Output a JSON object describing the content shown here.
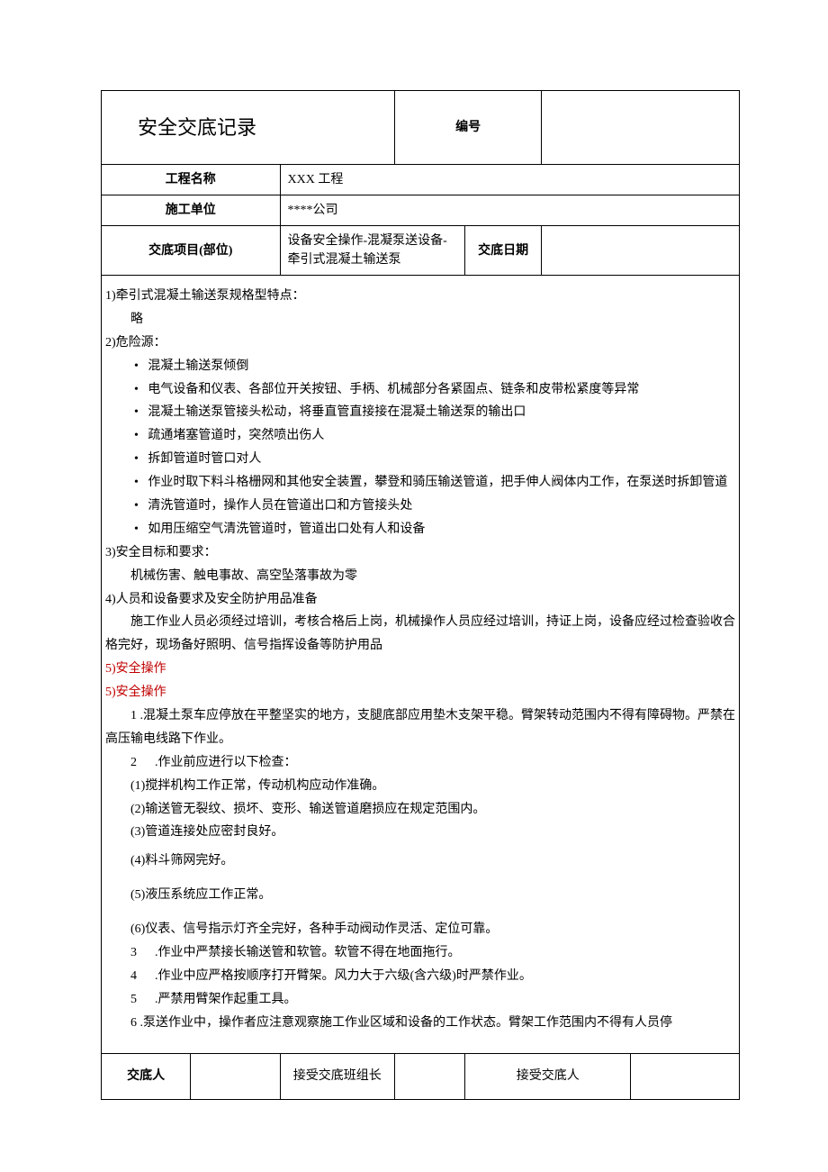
{
  "header": {
    "title": "安全交底记录",
    "serial_label": "编号",
    "serial_value": ""
  },
  "meta": {
    "project_label": "工程名称",
    "project_value": "XXX 工程",
    "unit_label": "施工单位",
    "unit_value": "****公司",
    "item_label": "交底项目(部位)",
    "item_value": "设备安全操作-混凝泵送设备-牵引式混凝土输送泵",
    "date_label": "交底日期",
    "date_value": ""
  },
  "body": {
    "s1_title": "1)牵引式混凝土输送泵规格型特点：",
    "s1_content": "略",
    "s2_title": "2)危险源：",
    "s2_items": [
      "混凝土输送泵倾倒",
      "电气设备和仪表、各部位开关按钮、手柄、机械部分各紧固点、链条和皮带松紧度等异常",
      "混凝土输送泵管接头松动，将垂直管直接接在混凝土输送泵的输出口",
      "疏通堵塞管道时，突然喷出伤人",
      "拆卸管道时管口对人",
      "作业时取下料斗格栅网和其他安全装置，攀登和骑压输送管道，把手伸人阀体内工作，在泵送时拆卸管道",
      "清洗管道时，操作人员在管道出口和方管接头处",
      "如用压缩空气清洗管道时，管道出口处有人和设备"
    ],
    "s3_title": "3)安全目标和要求：",
    "s3_content": "机械伤害、触电事故、高空坠落事故为零",
    "s4_title": "4)人员和设备要求及安全防护用品准备",
    "s4_content": "施工作业人员必须经过培训，考核合格后上岗，机械操作人员应经过培训，持证上岗，设备应经过检查验收合格完好，现场备好照明、信号指挥设备等防护用品",
    "s5_title_a": "5)安全操作",
    "s5_title_b": "5)安全操作",
    "op_1": "1   .混凝土泵车应停放在平整坚实的地方，支腿底部应用垫木支架平稳。臂架转动范围内不得有障碍物。严禁在高压输电线路下作业。",
    "op_2_pre": "2",
    "op_2_txt": ".作业前应进行以下检查：",
    "op_2_sub1": "(1)搅拌机构工作正常，传动机构应动作准确。",
    "op_2_sub2": "(2)输送管无裂纹、损坏、变形、输送管道磨损应在规定范围内。",
    "op_2_sub3": "(3)管道连接处应密封良好。",
    "op_2_sub4": "(4)料斗筛网完好。",
    "op_2_sub5": "(5)液压系统应工作正常。",
    "op_2_sub6": "(6)仪表、信号指示灯齐全完好，各种手动阀动作灵活、定位可靠。",
    "op_3_pre": "3",
    "op_3_txt": ".作业中严禁接长输送管和软管。软管不得在地面拖行。",
    "op_4_pre": "4",
    "op_4_txt": ".作业中应严格按顺序打开臂架。风力大于六级(含六级)时严禁作业。",
    "op_5_pre": "5",
    "op_5_txt": ".严禁用臂架作起重工具。",
    "op_6": "6   .泵送作业中，操作者应注意观察施工作业区域和设备的工作状态。臂架工作范围内不得有人员停"
  },
  "footer": {
    "sender_label": "交底人",
    "sender_value": "",
    "group_label": "接受交底班组长",
    "group_value": "",
    "receiver_label": "接受交底人",
    "receiver_value": ""
  }
}
